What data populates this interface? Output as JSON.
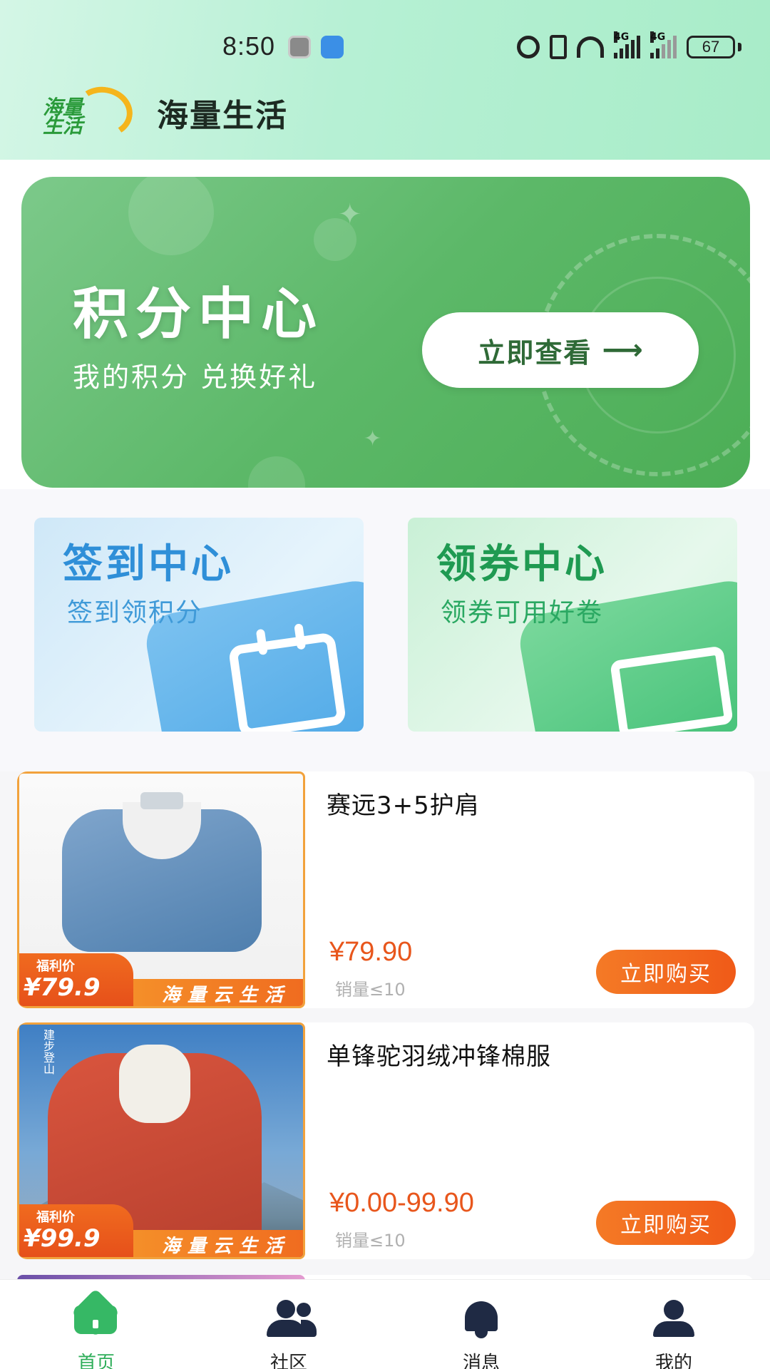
{
  "status_bar": {
    "time": "8:50",
    "battery": "67",
    "network_labels": [
      "4G",
      "4G"
    ]
  },
  "header": {
    "logo_text": "海量生活",
    "title": "海量生活"
  },
  "banner": {
    "title": "积分中心",
    "subtitle": "我的积分  兑换好礼",
    "button_label": "立即查看",
    "button_arrow": "⟶"
  },
  "feature_cards": [
    {
      "title": "签到中心",
      "subtitle": "签到领积分",
      "icon": "calendar-icon"
    },
    {
      "title": "领券中心",
      "subtitle": "领券可用好卷",
      "icon": "ticket-icon"
    }
  ],
  "products": [
    {
      "name": "赛远3+5护肩",
      "price": "¥79.90",
      "sales": "销量≤10",
      "buy_label": "立即购买",
      "tag_small": "福利价",
      "tag_price": "¥79.9",
      "tag_brand": "海量云生活"
    },
    {
      "name": "单锋驼羽绒冲锋棉服",
      "price": "¥0.00-99.90",
      "sales": "销量≤10",
      "buy_label": "立即购买",
      "tag_small": "福利价",
      "tag_price": "¥99.9",
      "tag_brand": "海量云生活",
      "image_side_text": "建步登山"
    }
  ],
  "tab_bar": {
    "active": "home",
    "tabs": [
      {
        "label": "首页",
        "icon": "home-icon"
      },
      {
        "label": "社区",
        "icon": "community-icon"
      },
      {
        "label": "消息",
        "icon": "bell-icon"
      },
      {
        "label": "我的",
        "icon": "user-icon"
      }
    ]
  },
  "colors": {
    "accent_green": "#36b865",
    "price_orange": "#e8561c",
    "buy_button": "#f05a18"
  }
}
